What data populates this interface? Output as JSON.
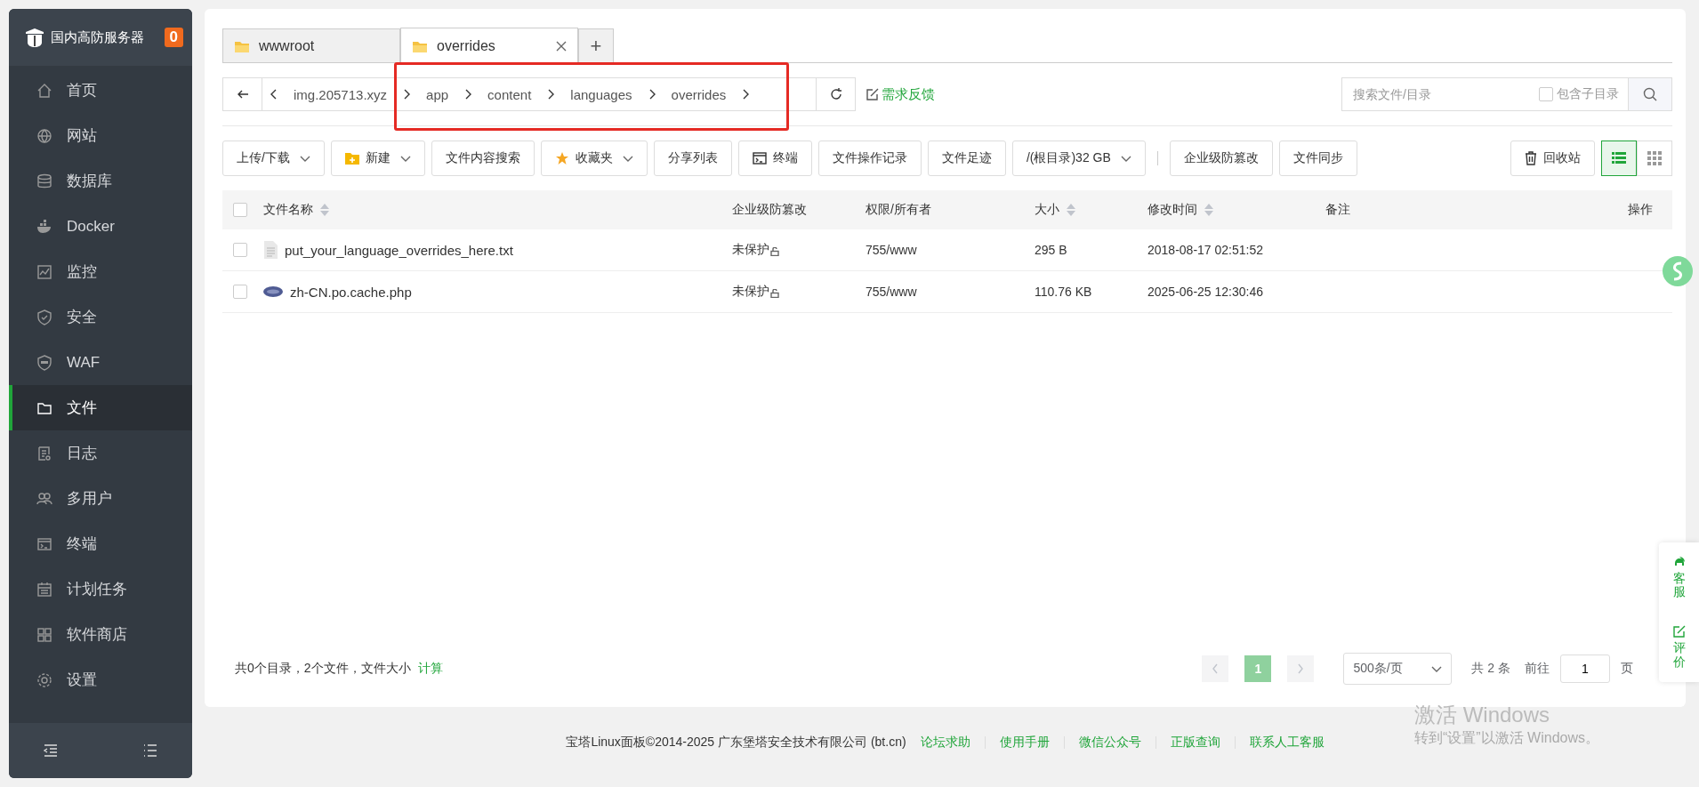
{
  "sidebar": {
    "title": "国内高防服务器",
    "badge": "0",
    "items": [
      {
        "label": "首页",
        "selected": false
      },
      {
        "label": "网站",
        "selected": false
      },
      {
        "label": "数据库",
        "selected": false
      },
      {
        "label": "Docker",
        "selected": false
      },
      {
        "label": "监控",
        "selected": false
      },
      {
        "label": "安全",
        "selected": false
      },
      {
        "label": "WAF",
        "selected": false
      },
      {
        "label": "文件",
        "selected": true
      },
      {
        "label": "日志",
        "selected": false
      },
      {
        "label": "多用户",
        "selected": false
      },
      {
        "label": "终端",
        "selected": false
      },
      {
        "label": "计划任务",
        "selected": false
      },
      {
        "label": "软件商店",
        "selected": false
      },
      {
        "label": "设置",
        "selected": false
      }
    ]
  },
  "tabs": [
    {
      "label": "wwwroot",
      "selected": false,
      "closable": false
    },
    {
      "label": "overrides",
      "selected": true,
      "closable": true
    }
  ],
  "add_tab": "+",
  "breadcrumb": [
    "img.205713.xyz",
    "app",
    "content",
    "languages",
    "overrides"
  ],
  "feedback_link": "需求反馈",
  "search": {
    "placeholder": "搜索文件/目录",
    "include_subdirs": {
      "label": "包含子目录",
      "checked": false
    }
  },
  "toolbar": [
    {
      "label": "上传/下载",
      "kind": "plain",
      "dropdown": true
    },
    {
      "label": "新建",
      "kind": "new",
      "dropdown": true
    },
    {
      "label": "文件内容搜索",
      "kind": "plain",
      "dropdown": false
    },
    {
      "label": "收藏夹",
      "kind": "star",
      "dropdown": true
    },
    {
      "label": "分享列表",
      "kind": "plain",
      "dropdown": false
    },
    {
      "label": "终端",
      "kind": "terminal",
      "dropdown": false
    },
    {
      "label": "文件操作记录",
      "kind": "plain",
      "dropdown": false
    },
    {
      "label": "文件足迹",
      "kind": "plain",
      "dropdown": false
    },
    {
      "label": "/(根目录)32 GB",
      "kind": "plain",
      "dropdown": true
    },
    {
      "label": "企业级防篡改",
      "kind": "plain",
      "dropdown": false,
      "separator_before": true
    },
    {
      "label": "文件同步",
      "kind": "plain",
      "dropdown": false
    }
  ],
  "recycle_button": "回收站",
  "view_modes": [
    {
      "selected": true
    },
    {
      "selected": false
    }
  ],
  "table": {
    "all_checked": false,
    "columns": [
      {
        "label": "文件名称",
        "sortable": true
      },
      {
        "label": "企业级防篡改",
        "sortable": false
      },
      {
        "label": "权限/所有者",
        "sortable": false
      },
      {
        "label": "大小",
        "sortable": true
      },
      {
        "label": "修改时间",
        "sortable": true
      },
      {
        "label": "备注",
        "sortable": false
      },
      {
        "label": "操作",
        "sortable": false
      }
    ],
    "rows": [
      {
        "kind": "text",
        "name": "put_your_language_overrides_here.txt",
        "protection": "未保护",
        "permission": "755/www",
        "size": "295 B",
        "modified": "2018-08-17 02:51:52",
        "checked": false
      },
      {
        "kind": "php",
        "name": "zh-CN.po.cache.php",
        "protection": "未保护",
        "permission": "755/www",
        "size": "110.76 KB",
        "modified": "2025-06-25 12:30:46",
        "checked": false
      }
    ]
  },
  "summary": {
    "text": "共0个目录，2个文件，文件大小",
    "link": "计算"
  },
  "pagination": {
    "pages": [
      {
        "label": "1",
        "selected": true
      }
    ],
    "page_size": "500条/页",
    "total": "共 2 条",
    "goto_label": "前往",
    "goto_value": "1",
    "page_unit": "页"
  },
  "float_widget": [
    "客服",
    "评价"
  ],
  "footer": {
    "copyright": "宝塔Linux面板©2014-2025 广东堡塔安全技术有限公司 (bt.cn)",
    "links": [
      "论坛求助",
      "使用手册",
      "微信公众号",
      "正版查询",
      "联系人工客服"
    ]
  },
  "os_notice": {
    "title": "激活 Windows",
    "text": "转到“设置”以激活 Windows。"
  }
}
